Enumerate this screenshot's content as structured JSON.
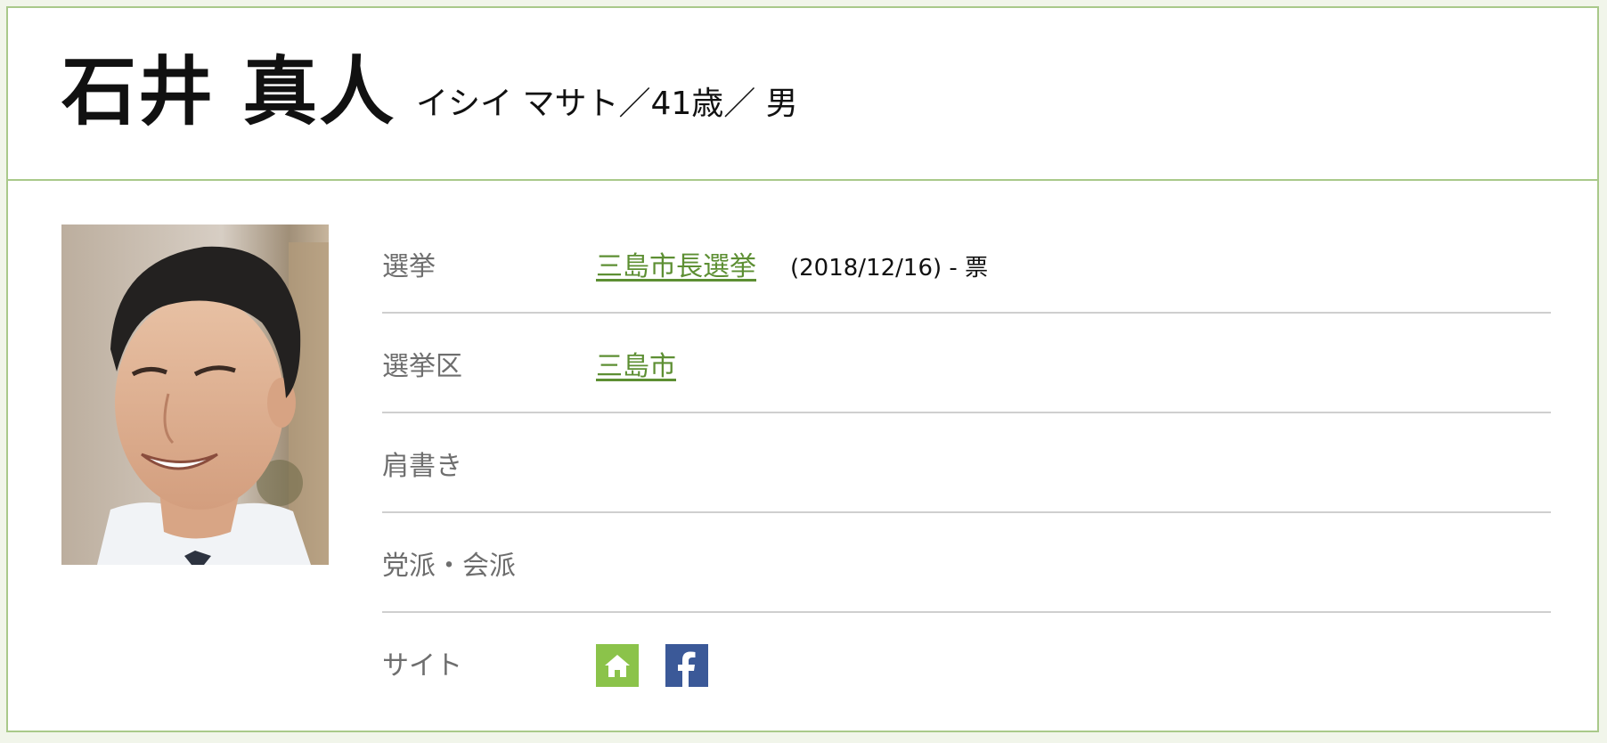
{
  "candidate": {
    "name": "石井 真人",
    "subtitle": "イシイ マサト／41歳／ 男"
  },
  "rows": {
    "election": {
      "label": "選挙",
      "link": "三島市長選挙",
      "date": "(2018/12/16)",
      "votes": " - 票"
    },
    "district": {
      "label": "選挙区",
      "link": "三島市"
    },
    "title": {
      "label": "肩書き",
      "value": ""
    },
    "party": {
      "label": "党派・会派",
      "value": ""
    },
    "site": {
      "label": "サイト",
      "icons": [
        "home-icon",
        "facebook-icon"
      ]
    }
  },
  "colors": {
    "accent_green": "#5d8f33",
    "border_green": "#a9c98a",
    "home_icon_bg": "#8bc34a",
    "facebook_bg": "#3b5998"
  }
}
